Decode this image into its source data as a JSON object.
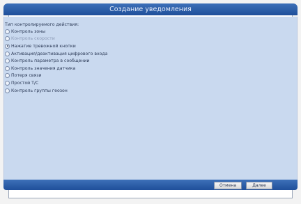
{
  "window": {
    "title": "Создание уведомления"
  },
  "form": {
    "group_label": "Тип контролируемого действия:",
    "options": [
      {
        "label": "Контроль зоны",
        "selected": false,
        "disabled": false
      },
      {
        "label": "Контроль скорости",
        "selected": false,
        "disabled": true
      },
      {
        "label": "Нажатие тревожной кнопки",
        "selected": true,
        "disabled": false
      },
      {
        "label": "Активация/деактивация цифрового входа",
        "selected": false,
        "disabled": false
      },
      {
        "label": "Контроль параметра в сообщении",
        "selected": false,
        "disabled": false
      },
      {
        "label": "Контроль значения датчика",
        "selected": false,
        "disabled": false
      },
      {
        "label": "Потеря связи",
        "selected": false,
        "disabled": false
      },
      {
        "label": "Простой Т/С",
        "selected": false,
        "disabled": false
      },
      {
        "label": "Контроль группы геозон",
        "selected": false,
        "disabled": false
      }
    ]
  },
  "footer": {
    "cancel_label": "Отмена",
    "next_label": "Далее"
  },
  "colors": {
    "title_bar": "#2f61ad",
    "content_bg": "#c9d9ef",
    "text": "#2c3a57"
  }
}
